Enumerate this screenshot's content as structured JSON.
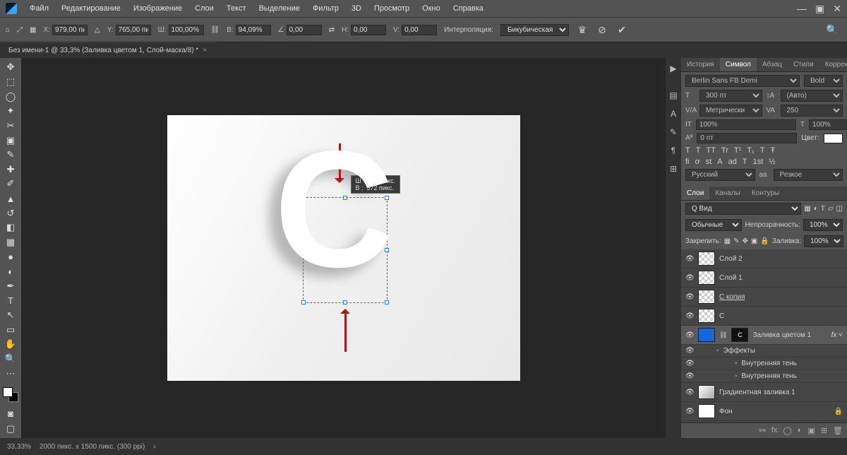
{
  "menus": [
    "Файл",
    "Редактирование",
    "Изображение",
    "Слои",
    "Текст",
    "Выделение",
    "Фильтр",
    "3D",
    "Просмотр",
    "Окно",
    "Справка"
  ],
  "optbar": {
    "x_lbl": "X:",
    "x": "979,00 пи",
    "y_lbl": "Y:",
    "y": "765,00 пи",
    "w_lbl": "Ш:",
    "w": "100,00%",
    "link": "⛓",
    "h_lbl": "В:",
    "h": "94,09%",
    "a_lbl": "∠",
    "a": "0,00",
    "hskew_lbl": "H:",
    "hskew": "0,00",
    "vskew_lbl": "V:",
    "vskew": "0,00",
    "interp_lbl": "Интерполяция:",
    "interp": "Бикубическая"
  },
  "doctab": "Без имени-1 @ 33,3% (Заливка цветом 1, Слой-маска/8) *",
  "tooltip": "Ш :  442 пикс.\nВ :  572 пикс.",
  "panel_tabs_top": [
    "История",
    "Символ",
    "Абзац",
    "Стили",
    "Коррекция"
  ],
  "char": {
    "font": "Berlin Sans FB Demi",
    "weight": "Bold",
    "size": "300 пт",
    "leading": "(Авто)",
    "kerning": "Метрически",
    "tracking": "250",
    "vscale": "100%",
    "hscale": "100%",
    "baseline": "0 пт",
    "color_lbl": "Цвет:",
    "btns1": [
      "T",
      "T",
      "TT",
      "Tr",
      "T¹",
      "T₁",
      "T",
      "Ŧ"
    ],
    "btns2": [
      "fi",
      "ơ",
      "st",
      "A",
      "ad",
      "T",
      "1st",
      "½"
    ],
    "lang": "Русский",
    "aa": "Резкое"
  },
  "panel_tabs_layers": [
    "Слои",
    "Каналы",
    "Контуры"
  ],
  "layers_panel": {
    "search": "Q Вид",
    "blend": "Обычные",
    "opacity_lbl": "Непрозрачность:",
    "opacity": "100%",
    "lock_lbl": "Закрепить:",
    "fill_lbl": "Заливка:",
    "fill": "100%"
  },
  "layers": [
    {
      "name": "Слой 2",
      "thumb": "checker"
    },
    {
      "name": "Слой 1",
      "thumb": "checker"
    },
    {
      "name": "С копия",
      "thumb": "checker",
      "under": true
    },
    {
      "name": "С",
      "thumb": "checker"
    },
    {
      "name": "Заливка цветом 1",
      "thumb": "blue",
      "mask": "black",
      "sel": true,
      "fx": true
    },
    {
      "name": "Эффекты",
      "indent": 1,
      "effect": true
    },
    {
      "name": "Внутренняя тень",
      "indent": 2,
      "effect": true
    },
    {
      "name": "Внутренняя тень",
      "indent": 2,
      "effect": true
    },
    {
      "name": "Градиентная заливка 1",
      "thumb": "grad"
    },
    {
      "name": "Фон",
      "thumb": "white",
      "lock": true
    }
  ],
  "status": {
    "zoom": "33,33%",
    "dims": "2000 пикс. x 1500 пикс. (300 ppi)"
  }
}
